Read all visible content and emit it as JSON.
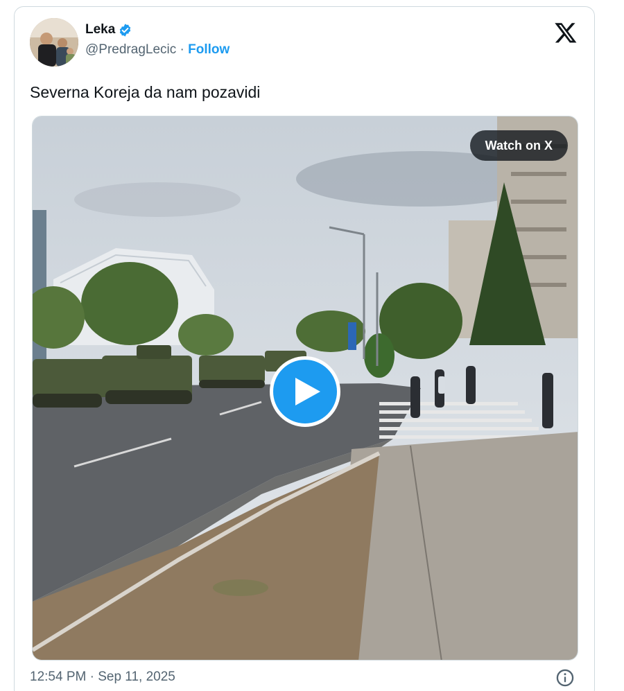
{
  "author": {
    "display_name": "Leka",
    "handle": "@PredragLecic",
    "separator": "·",
    "follow_label": "Follow"
  },
  "tweet": {
    "text": "Severna Koreja da nam pozavidi",
    "timestamp": "12:54 PM · Sep 11, 2025"
  },
  "media": {
    "watch_label": "Watch on X"
  },
  "icons": {
    "verified": "verified-badge-icon",
    "brand": "x-logo-icon",
    "play": "play-icon",
    "info": "info-icon"
  },
  "colors": {
    "accent": "#1d9bf0",
    "text": "#0f1419",
    "muted": "#536471",
    "border": "#cfd9de"
  }
}
